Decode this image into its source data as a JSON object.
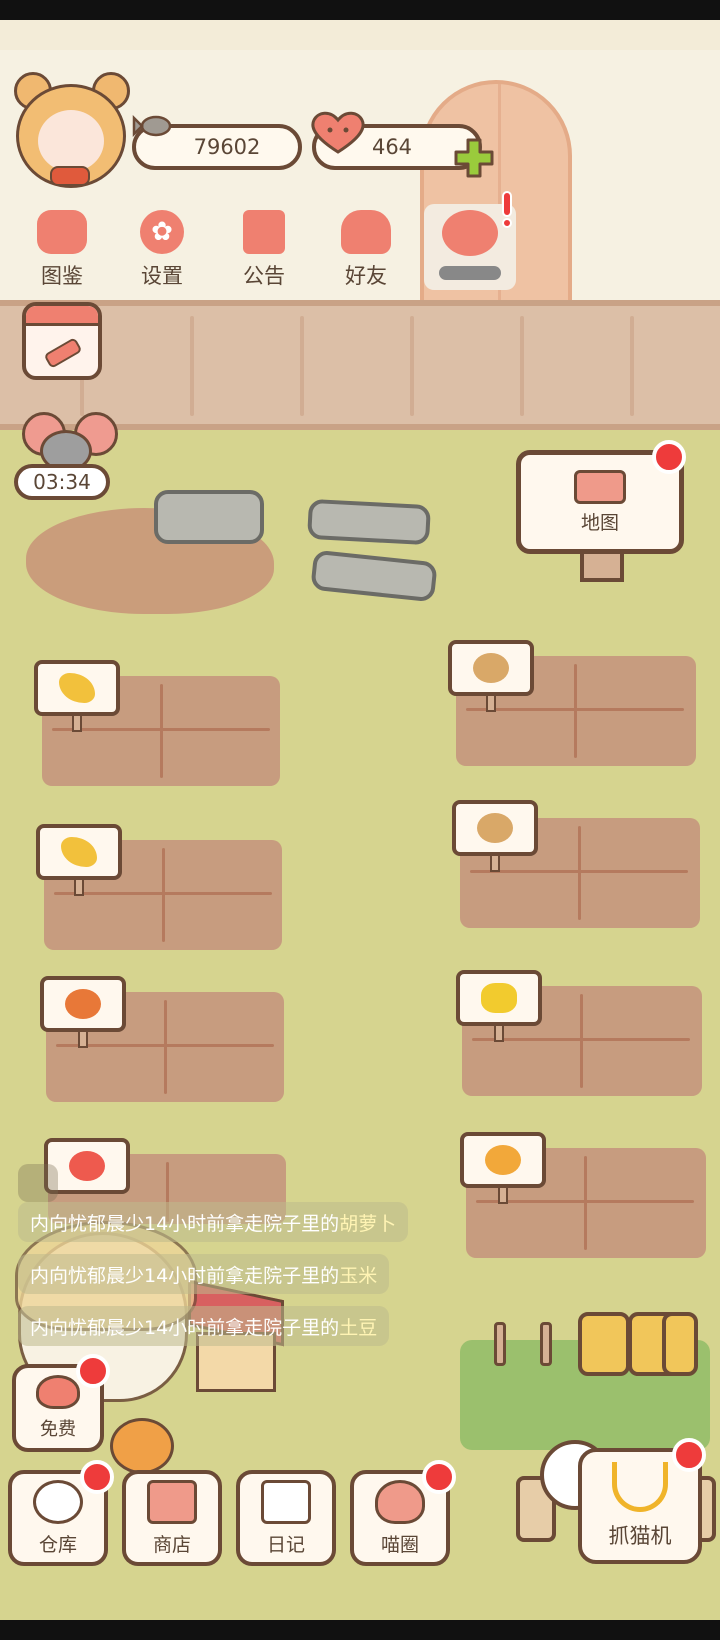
{
  "currencies": {
    "fish": "79602",
    "hearts": "464"
  },
  "top_menu": [
    {
      "label": "图鉴",
      "icon": "cat-head-icon"
    },
    {
      "label": "设置",
      "icon": "gear-icon"
    },
    {
      "label": "公告",
      "icon": "gift-icon"
    },
    {
      "label": "好友",
      "icon": "friends-icon"
    }
  ],
  "timer": "03:34",
  "map_label": "地图",
  "feed": {
    "msg1": {
      "prefix": "内向忧郁晨少14小时前拿走院子里的",
      "item": "胡萝卜"
    },
    "msg2": {
      "prefix": "内向忧郁晨少14小时前拿走院子里的",
      "item": "玉米"
    },
    "msg3": {
      "prefix": "内向忧郁晨少14小时前拿走院子里的",
      "item": "土豆"
    }
  },
  "crops": {
    "left": [
      "wheat",
      "wheat",
      "carrot",
      "tomato"
    ],
    "right": [
      "potato",
      "potato",
      "corn",
      "mango"
    ]
  },
  "free_label": "免费",
  "bottom_nav": {
    "warehouse": "仓库",
    "shop": "商店",
    "diary": "日记",
    "circle": "喵圈",
    "claw": "抓猫机"
  },
  "colors": {
    "notification_red": "#ee3b3b",
    "button_pink": "#ef8070",
    "outline_brown": "#6b4a36"
  }
}
